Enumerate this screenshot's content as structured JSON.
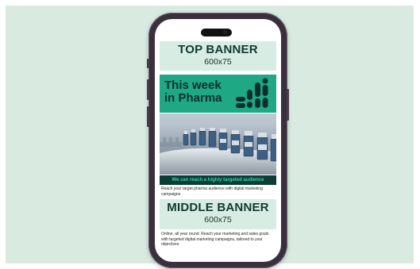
{
  "top_banner": {
    "title": "TOP BANNER",
    "size": "600x75"
  },
  "hero": {
    "title_line1": "This week",
    "title_line2": "in Pharma",
    "icon": "pills-icon",
    "background": "#1ea884"
  },
  "reach_bar": {
    "text": "We can reach a highly targeted audience"
  },
  "paragraph_1": "Reach your target pharma audience with digital marketing campaigns.",
  "middle_banner": {
    "title": "MIDDLE BANNER",
    "size": "600x75"
  },
  "paragraph_2": "Online, all year round. Reach your marketing and sales goals with targeted digital marketing campaigns, tailored to your objectives.",
  "colors": {
    "backdrop": "#d9ebe1",
    "banner": "#d7ece2",
    "dark_green": "#0b3d34",
    "accent_green": "#2fd9a5",
    "phone_body": "#3a2f3d"
  }
}
